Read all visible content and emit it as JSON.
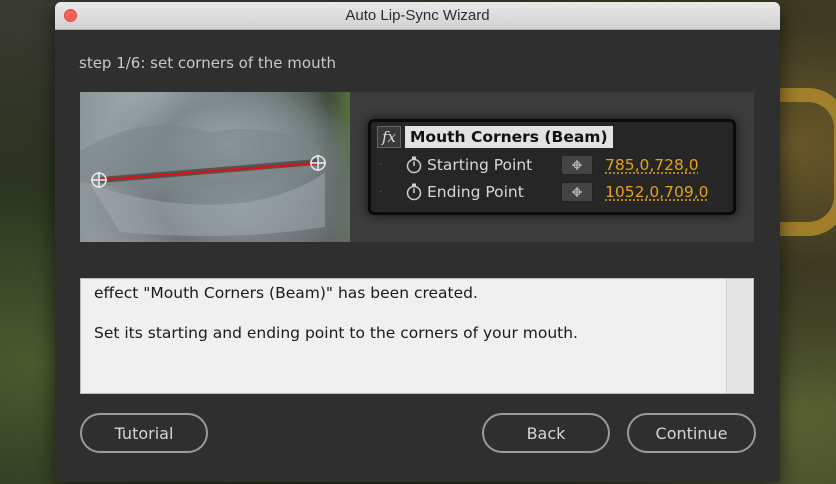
{
  "window": {
    "title": "Auto Lip-Sync Wizard"
  },
  "wizard": {
    "step_label": "step 1/6: set corners of the mouth"
  },
  "effect_panel": {
    "fx_badge": "fx",
    "effect_name": "Mouth Corners (Beam)",
    "properties": [
      {
        "label": "Starting Point",
        "value": "785,0,728,0"
      },
      {
        "label": "Ending Point",
        "value": "1052,0,709,0"
      }
    ]
  },
  "message": {
    "line1": "effect \"Mouth Corners (Beam)\" has been created.",
    "line2": "Set its starting and ending point to the corners of your mouth."
  },
  "buttons": {
    "tutorial": "Tutorial",
    "back": "Back",
    "continue": "Continue"
  },
  "colors": {
    "close_button": "#fc5f57",
    "property_value": "#e6a317",
    "beam_line": "#d01818"
  }
}
